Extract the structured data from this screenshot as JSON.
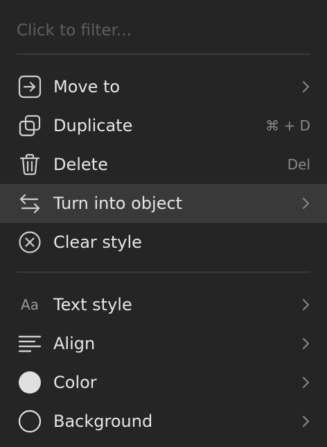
{
  "filter": {
    "placeholder": "Click to filter..."
  },
  "items": [
    {
      "label": "Move to",
      "icon": "move-to-icon",
      "submenu": true
    },
    {
      "label": "Duplicate",
      "icon": "duplicate-icon",
      "shortcut": "⌘ + D"
    },
    {
      "label": "Delete",
      "icon": "trash-icon",
      "shortcut": "Del"
    },
    {
      "label": "Turn into object",
      "icon": "swap-arrows-icon",
      "submenu": true,
      "highlighted": true
    },
    {
      "label": "Clear style",
      "icon": "clear-circle-icon"
    },
    {
      "label": "Text style",
      "icon": "text-style-icon",
      "glyph": "Aa",
      "submenu": true
    },
    {
      "label": "Align",
      "icon": "align-left-icon",
      "submenu": true
    },
    {
      "label": "Color",
      "icon": "color-swatch-icon",
      "submenu": true
    },
    {
      "label": "Background",
      "icon": "background-circle-icon",
      "submenu": true
    }
  ],
  "colors": {
    "background": "#252525",
    "highlight": "#393939",
    "text": "#e6e6e6",
    "muted": "#8a8a8a",
    "divider": "#3a3a3a",
    "color_swatch": "#e0e0e0"
  }
}
